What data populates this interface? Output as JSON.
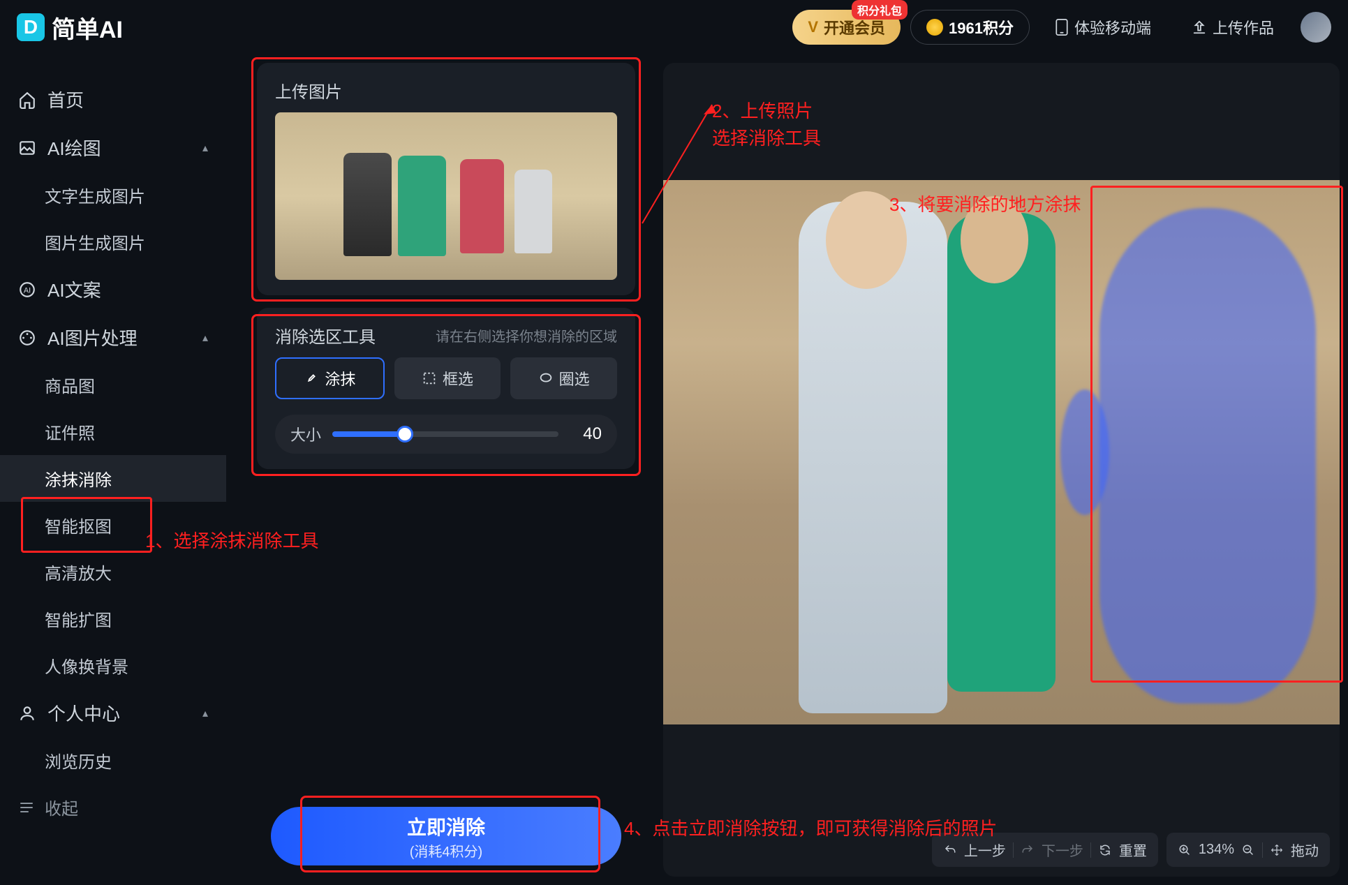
{
  "app": {
    "logo_letter": "D",
    "name": "简单AI"
  },
  "header": {
    "vip_label": "开通会员",
    "vip_badge": "积分礼包",
    "points_label": "1961积分",
    "mobile_label": "体验移动端",
    "upload_label": "上传作品"
  },
  "sidebar": {
    "home": "首页",
    "ai_draw": "AI绘图",
    "ai_draw_children": {
      "text2img": "文字生成图片",
      "img2img": "图片生成图片"
    },
    "ai_copy": "AI文案",
    "ai_image": "AI图片处理",
    "ai_image_children": {
      "product": "商品图",
      "idphoto": "证件照",
      "erase": "涂抹消除",
      "cutout": "智能抠图",
      "upscale": "高清放大",
      "expand": "智能扩图",
      "bgswap": "人像换背景"
    },
    "profile": "个人中心",
    "profile_children": {
      "history": "浏览历史"
    },
    "collapse": "收起"
  },
  "panel": {
    "upload_title": "上传图片",
    "tool_title": "消除选区工具",
    "tool_hint": "请在右侧选择你想消除的区域",
    "brush": "涂抹",
    "box": "框选",
    "lasso": "圈选",
    "size_label": "大小",
    "size_value": "40",
    "action_title": "立即消除",
    "action_sub": "(消耗4积分)"
  },
  "canvas_toolbar": {
    "undo": "上一步",
    "redo": "下一步",
    "reset": "重置",
    "zoom": "134%",
    "drag": "拖动"
  },
  "annotations": {
    "a1": "1、选择涂抹消除工具",
    "a2_l1": "2、上传照片",
    "a2_l2": "选择消除工具",
    "a3": "3、将要消除的地方涂抹",
    "a4": "4、点击立即消除按钮，即可获得消除后的照片"
  }
}
